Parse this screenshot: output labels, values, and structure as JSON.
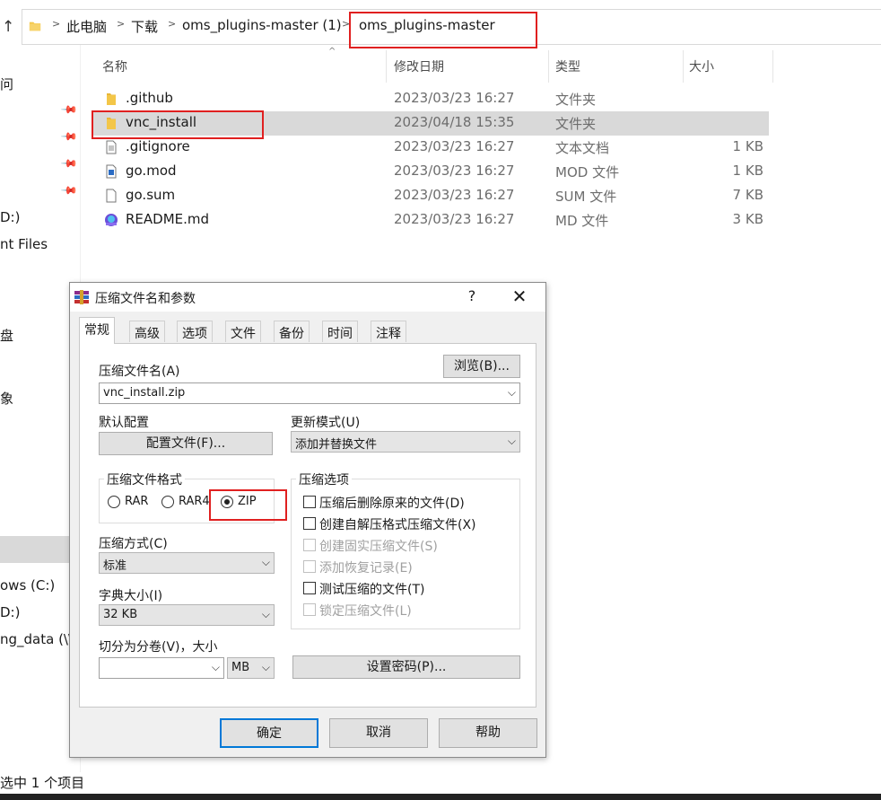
{
  "breadcrumb": {
    "items": [
      "此电脑",
      "下载",
      "oms_plugins-master (1)",
      "oms_plugins-master"
    ]
  },
  "nav": {
    "items": [
      "问",
      "D:)",
      "nt Files",
      "盘",
      "象",
      "ows (C:)",
      "D:)",
      "ng_data (\\\\"
    ]
  },
  "columns": {
    "name": "名称",
    "date": "修改日期",
    "type": "类型",
    "size": "大小"
  },
  "files": [
    {
      "name": ".github",
      "date": "2023/03/23 16:27",
      "type": "文件夹",
      "size": "",
      "icon": "folder-icon"
    },
    {
      "name": "vnc_install",
      "date": "2023/04/18 15:35",
      "type": "文件夹",
      "size": "",
      "icon": "folder-icon",
      "selected": true
    },
    {
      "name": ".gitignore",
      "date": "2023/03/23 16:27",
      "type": "文本文档",
      "size": "1 KB",
      "icon": "text-file-icon"
    },
    {
      "name": "go.mod",
      "date": "2023/03/23 16:27",
      "type": "MOD 文件",
      "size": "1 KB",
      "icon": "mod-file-icon"
    },
    {
      "name": "go.sum",
      "date": "2023/03/23 16:27",
      "type": "SUM 文件",
      "size": "7 KB",
      "icon": "blank-file-icon"
    },
    {
      "name": "README.md",
      "date": "2023/03/23 16:27",
      "type": "MD 文件",
      "size": "3 KB",
      "icon": "markdown-file-icon"
    }
  ],
  "status": {
    "text": "选中 1 个项目"
  },
  "dialog": {
    "title": "压缩文件名和参数",
    "help": "?",
    "close": "✕",
    "tabs": [
      "常规",
      "高级",
      "选项",
      "文件",
      "备份",
      "时间",
      "注释"
    ],
    "archive_name_label": "压缩文件名(A)",
    "browse_label": "浏览(B)...",
    "archive_name_value": "vnc_install.zip",
    "default_profile_label": "默认配置",
    "profiles_button": "配置文件(F)...",
    "update_mode_label": "更新模式(U)",
    "update_mode_value": "添加并替换文件",
    "format_group_title": "压缩文件格式",
    "formats": [
      "RAR",
      "RAR4",
      "ZIP"
    ],
    "selected_format": "ZIP",
    "options_group_title": "压缩选项",
    "options": [
      {
        "label": "压缩后删除原来的文件(D)",
        "enabled": true,
        "checked": false
      },
      {
        "label": "创建自解压格式压缩文件(X)",
        "enabled": true,
        "checked": false
      },
      {
        "label": "创建固实压缩文件(S)",
        "enabled": false,
        "checked": false
      },
      {
        "label": "添加恢复记录(E)",
        "enabled": false,
        "checked": false
      },
      {
        "label": "测试压缩的文件(T)",
        "enabled": true,
        "checked": false
      },
      {
        "label": "锁定压缩文件(L)",
        "enabled": false,
        "checked": false
      }
    ],
    "method_label": "压缩方式(C)",
    "method_value": "标准",
    "dict_label": "字典大小(I)",
    "dict_value": "32 KB",
    "split_label": "切分为分卷(V)，大小",
    "split_value": "",
    "split_unit": "MB",
    "password_button": "设置密码(P)...",
    "ok_button": "确定",
    "cancel_button": "取消",
    "help_button": "帮助"
  },
  "colors": {
    "highlight_border": "#e02020",
    "selection_bg": "#d9d9d9",
    "folder_yellow": "#f3c648",
    "default_button_border": "#0078d7"
  }
}
